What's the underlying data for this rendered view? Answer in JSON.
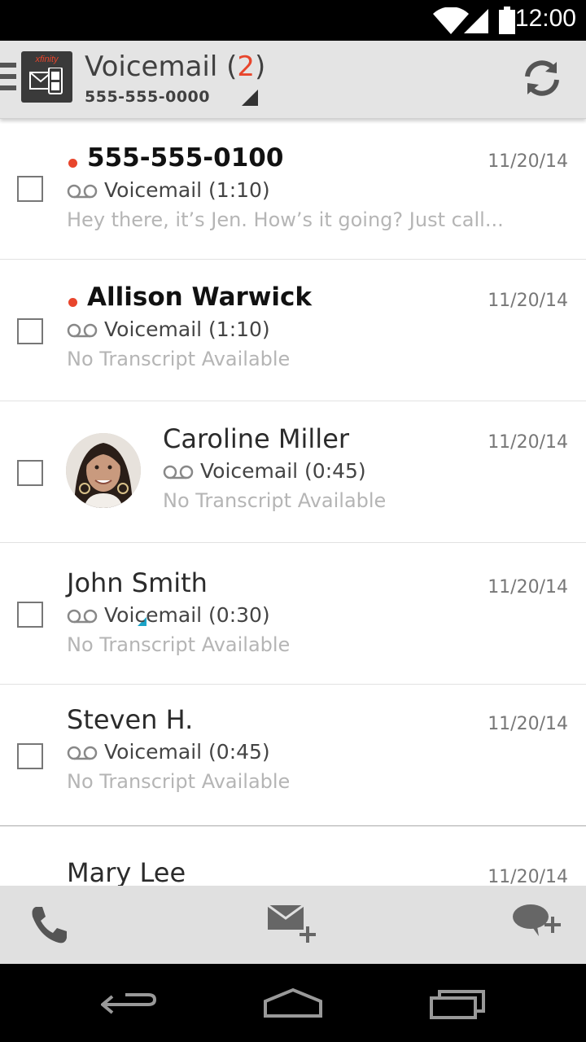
{
  "status_bar": {
    "time": "12:00",
    "icons": [
      "wifi-icon",
      "signal-icon",
      "battery-icon"
    ]
  },
  "header": {
    "brand": "xfinity",
    "title": "Voicemail",
    "count_open": "(",
    "count": "2",
    "count_close": ")",
    "phone": "555-555-0000",
    "icons": [
      "menu-icon",
      "app-logo-icon",
      "dropdown-triangle-icon",
      "refresh-icon"
    ]
  },
  "messages": [
    {
      "name": "555-555-0100",
      "unread": true,
      "date": "11/20/14",
      "type": "Voicemail (1:10)",
      "transcript": "Hey there, it’s Jen. How’s it going? Just call..."
    },
    {
      "name": "Allison Warwick",
      "unread": true,
      "date": "11/20/14",
      "type": "Voicemail (1:10)",
      "transcript": "No Transcript Available"
    },
    {
      "name": "Caroline Miller",
      "unread": false,
      "date": "11/20/14",
      "type": "Voicemail (0:45)",
      "transcript": "No Transcript Available",
      "has_avatar": true
    },
    {
      "name": "John Smith",
      "unread": false,
      "date": "11/20/14",
      "type": "Voicemail (0:30)",
      "transcript": "No Transcript Available"
    },
    {
      "name": "Steven H.",
      "unread": false,
      "date": "11/20/14",
      "type": "Voicemail (0:45)",
      "transcript": "No Transcript Available"
    },
    {
      "name": "Mary Lee",
      "unread": false,
      "date": "11/20/14"
    }
  ],
  "toolbar": {
    "icons": [
      "phone-icon",
      "compose-message-icon",
      "new-chat-icon"
    ]
  },
  "nav": {
    "icons": [
      "back-icon",
      "home-icon",
      "recents-icon"
    ]
  },
  "colors": {
    "accent": "#e8452c",
    "header_bg": "#e4e4e4",
    "avatar_marker": "#1ba3c7"
  }
}
